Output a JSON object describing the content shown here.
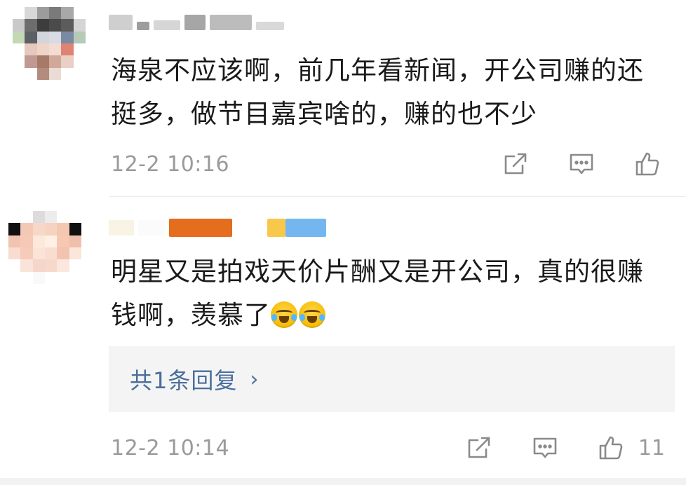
{
  "comments": [
    {
      "text": "海泉不应该啊，前几年看新闻，开公司赚的还挺多，做节目嘉宾啥的，赚的也不少",
      "time": "12-2 10:16",
      "likes": "",
      "actions": [
        "share-icon",
        "comment-icon",
        "like-icon"
      ]
    },
    {
      "text": "明星又是拍戏天价片酬又是开公司，真的很赚钱啊，羡慕了",
      "emojis": [
        "crying-laughing-emoji",
        "crying-laughing-emoji"
      ],
      "replies_label": "共1条回复",
      "reply_chevron": "›",
      "time": "12-2 10:14",
      "likes": "11",
      "actions": [
        "share-icon",
        "comment-icon",
        "like-icon"
      ]
    }
  ],
  "colors": {
    "text": "#1a1a1a",
    "meta": "#9a9a9a",
    "reply_link": "#4a6e9c",
    "reply_bg": "#f4f4f4",
    "username_orange": "#e46d1e",
    "username_blue": "#74b6ef",
    "username_yellow": "#f7c84a"
  }
}
